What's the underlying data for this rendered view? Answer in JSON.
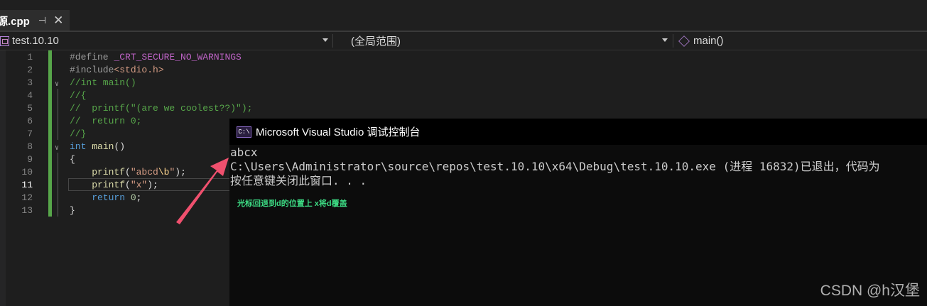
{
  "tab": {
    "filename": "源.cpp",
    "pin_glyph": "⊣",
    "close_glyph": "✕"
  },
  "navbar": {
    "project": "test.10.10",
    "scope": "(全局范围)",
    "member": "main()"
  },
  "editor": {
    "lines": [
      {
        "num": "1",
        "tokens": [
          {
            "t": "#define ",
            "c": "c-pp"
          },
          {
            "t": "_CRT_SECURE_NO_WARNINGS",
            "c": "c-mac"
          }
        ]
      },
      {
        "num": "2",
        "tokens": [
          {
            "t": "#include",
            "c": "c-pp"
          },
          {
            "t": "<stdio.h>",
            "c": "c-inc"
          }
        ]
      },
      {
        "num": "3",
        "fold": "∨",
        "tokens": [
          {
            "t": "//int main()",
            "c": "c-com"
          }
        ]
      },
      {
        "num": "4",
        "tokens": [
          {
            "t": "//{",
            "c": "c-com"
          }
        ]
      },
      {
        "num": "5",
        "tokens": [
          {
            "t": "//  printf(\"(are we coolest??)\");",
            "c": "c-com"
          }
        ]
      },
      {
        "num": "6",
        "tokens": [
          {
            "t": "//  return 0;",
            "c": "c-com"
          }
        ]
      },
      {
        "num": "7",
        "tokens": [
          {
            "t": "//}",
            "c": "c-com"
          }
        ]
      },
      {
        "num": "8",
        "fold": "∨",
        "tokens": [
          {
            "t": "int ",
            "c": "c-kw"
          },
          {
            "t": "main",
            "c": "c-fn"
          },
          {
            "t": "()",
            "c": "c-pl"
          }
        ]
      },
      {
        "num": "9",
        "tokens": [
          {
            "t": "{",
            "c": "c-pl"
          }
        ]
      },
      {
        "num": "10",
        "tokens": [
          {
            "t": "    printf",
            "c": "c-fn"
          },
          {
            "t": "(",
            "c": "c-pl"
          },
          {
            "t": "\"abcd",
            "c": "c-str"
          },
          {
            "t": "\\b",
            "c": "c-esc"
          },
          {
            "t": "\"",
            "c": "c-str"
          },
          {
            "t": ");",
            "c": "c-pl"
          }
        ]
      },
      {
        "num": "11",
        "tokens": [
          {
            "t": "    printf",
            "c": "c-fn"
          },
          {
            "t": "(",
            "c": "c-pl"
          },
          {
            "t": "\"x\"",
            "c": "c-str"
          },
          {
            "t": ");",
            "c": "c-pl"
          }
        ]
      },
      {
        "num": "12",
        "tokens": [
          {
            "t": "    return ",
            "c": "c-kw"
          },
          {
            "t": "0",
            "c": "c-num"
          },
          {
            "t": ";",
            "c": "c-pl"
          }
        ]
      },
      {
        "num": "13",
        "tokens": [
          {
            "t": "}",
            "c": "c-pl"
          }
        ]
      }
    ],
    "current_line": "11"
  },
  "console": {
    "title": "Microsoft Visual Studio 调试控制台",
    "icon_text": "C:\\",
    "output": [
      "abcx",
      "C:\\Users\\Administrator\\source\\repos\\test.10.10\\x64\\Debug\\test.10.10.exe (进程 16832)已退出，代码为",
      "按任意键关闭此窗口. . ."
    ],
    "annotation": "光标回退到d的位置上 x将d覆盖"
  },
  "watermark": "CSDN @h汉堡",
  "colors": {
    "arrow": "#f0506e",
    "annotation": "#3ddc84",
    "gutter_change": "#57a64a"
  }
}
